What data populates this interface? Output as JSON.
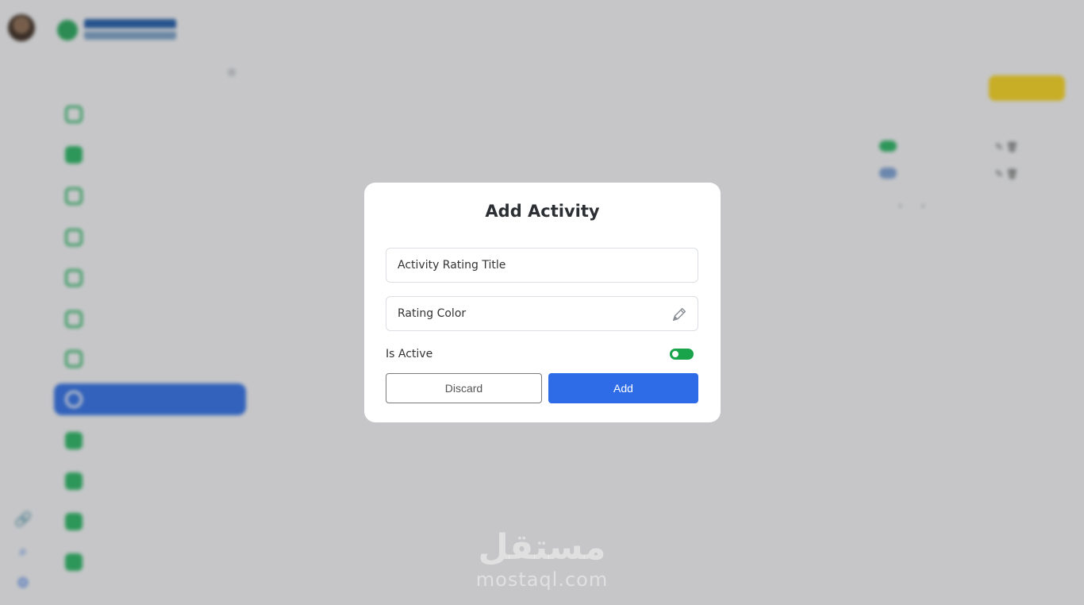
{
  "modal": {
    "title": "Add Activity",
    "title_field_placeholder": "Activity Rating Title",
    "color_field_placeholder": "Rating Color",
    "is_active_label": "Is Active",
    "is_active": true,
    "discard_label": "Discard",
    "add_label": "Add",
    "primary_color": "#2e6be6",
    "toggle_color": "#19a34a"
  },
  "watermark": {
    "arabic": "مستقل",
    "latin": "mostaql.com"
  },
  "colors": {
    "sidebar_active": "#2f6fe6",
    "accent_green": "#28b463",
    "add_new_button": "#f7d31f"
  }
}
